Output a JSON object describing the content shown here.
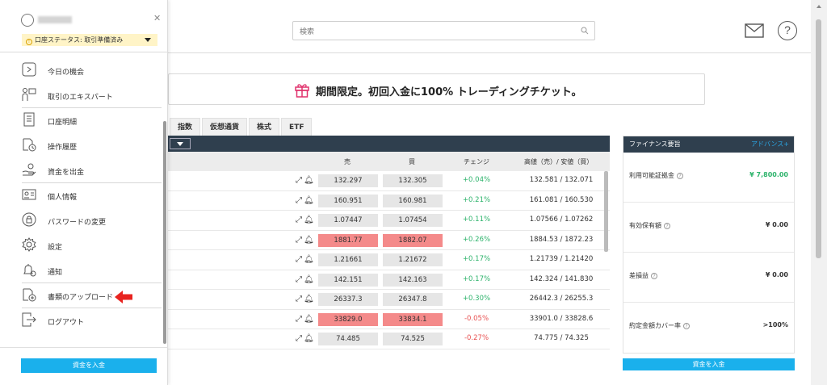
{
  "header": {
    "search_placeholder": "検索",
    "mail_icon": "mail-icon",
    "help_label": "?"
  },
  "banner": {
    "text": "期間限定。初回入金に100% トレーディングチケット。",
    "icon": "gift-icon"
  },
  "tabs": [
    "指数",
    "仮想通貨",
    "株式",
    "ETF"
  ],
  "quote_table": {
    "columns": {
      "sell": "売",
      "buy": "買",
      "change": "チェンジ",
      "high_low": "高値（売）/ 安値（買）"
    },
    "rows": [
      {
        "sell": "132.297",
        "buy": "132.305",
        "change": "+0.04%",
        "dir": "up",
        "high_low": "132.581 / 132.071",
        "hot": false
      },
      {
        "sell": "160.951",
        "buy": "160.981",
        "change": "+0.21%",
        "dir": "up",
        "high_low": "161.081 / 160.530",
        "hot": false
      },
      {
        "sell": "1.07447",
        "buy": "1.07454",
        "change": "+0.11%",
        "dir": "up",
        "high_low": "1.07566 / 1.07262",
        "hot": false
      },
      {
        "sell": "1881.77",
        "buy": "1882.07",
        "change": "+0.26%",
        "dir": "up",
        "high_low": "1884.53 / 1872.23",
        "hot": true
      },
      {
        "sell": "1.21661",
        "buy": "1.21672",
        "change": "+0.17%",
        "dir": "up",
        "high_low": "1.21739 / 1.21420",
        "hot": false
      },
      {
        "sell": "142.151",
        "buy": "142.163",
        "change": "+0.17%",
        "dir": "up",
        "high_low": "142.324 / 141.830",
        "hot": false
      },
      {
        "sell": "26337.3",
        "buy": "26347.8",
        "change": "+0.30%",
        "dir": "up",
        "high_low": "26442.3 / 26255.3",
        "hot": false
      },
      {
        "sell": "33829.0",
        "buy": "33834.1",
        "change": "-0.05%",
        "dir": "down",
        "high_low": "33901.0 / 33828.6",
        "hot": true
      },
      {
        "sell": "74.485",
        "buy": "74.525",
        "change": "-0.27%",
        "dir": "down",
        "high_low": "74.775 / 74.325",
        "hot": false
      }
    ]
  },
  "finance": {
    "title": "ファイナンス要旨",
    "advanced": "アドバンス+",
    "items": [
      {
        "label": "利用可能証拠金",
        "value": "¥ 7,800.00",
        "green": true
      },
      {
        "label": "有効保有額",
        "value": "¥ 0.00",
        "green": false
      },
      {
        "label": "差損益",
        "value": "¥ 0.00",
        "green": false
      },
      {
        "label": "約定金額カバー率",
        "value": ">100%",
        "green": false
      }
    ],
    "deposit_label": "資金を入金"
  },
  "sidebar": {
    "status_label": "口座ステータス: 取引準備済み",
    "menu": [
      {
        "label": "今日の機会",
        "icon": "play-icon",
        "sep": false
      },
      {
        "label": "取引のエキスパート",
        "icon": "expert-icon",
        "sep": true
      },
      {
        "label": "口座明細",
        "icon": "statement-icon",
        "sep": false
      },
      {
        "label": "操作履歴",
        "icon": "history-icon",
        "sep": false
      },
      {
        "label": "資金を出金",
        "icon": "withdraw-icon",
        "sep": true
      },
      {
        "label": "個人情報",
        "icon": "id-card-icon",
        "sep": false
      },
      {
        "label": "パスワードの変更",
        "icon": "lock-icon",
        "sep": false
      },
      {
        "label": "設定",
        "icon": "gear-icon",
        "sep": false
      },
      {
        "label": "通知",
        "icon": "bell-icon",
        "sep": true
      },
      {
        "label": "書類のアップロード",
        "icon": "upload-icon",
        "sep": true
      },
      {
        "label": "ログアウト",
        "icon": "logout-icon",
        "sep": false
      }
    ],
    "deposit_label": "資金を入金",
    "accent": "#1ab0ec"
  }
}
